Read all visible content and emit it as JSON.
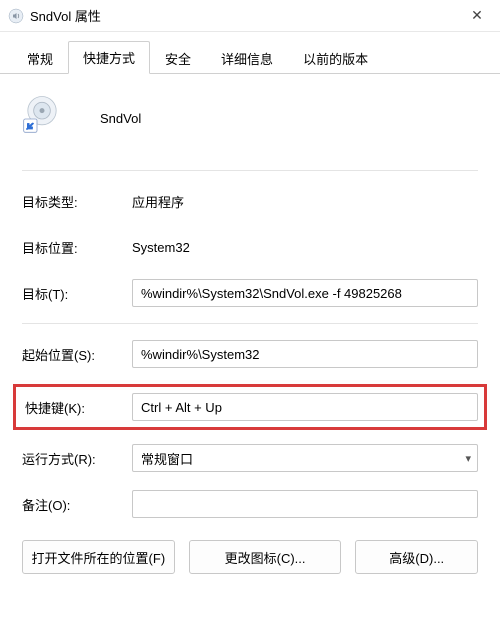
{
  "titlebar": {
    "title": "SndVol 属性",
    "close_glyph": "✕"
  },
  "tabs": [
    {
      "label": "常规",
      "active": false
    },
    {
      "label": "快捷方式",
      "active": true
    },
    {
      "label": "安全",
      "active": false
    },
    {
      "label": "详细信息",
      "active": false
    },
    {
      "label": "以前的版本",
      "active": false
    }
  ],
  "header": {
    "app_name": "SndVol"
  },
  "fields": {
    "target_type_label": "目标类型:",
    "target_type_value": "应用程序",
    "target_location_label": "目标位置:",
    "target_location_value": "System32",
    "target_label": "目标(T):",
    "target_value": "%windir%\\System32\\SndVol.exe -f 49825268",
    "start_in_label": "起始位置(S):",
    "start_in_value": "%windir%\\System32",
    "shortcut_key_label": "快捷键(K):",
    "shortcut_key_value": "Ctrl + Alt + Up",
    "run_label": "运行方式(R):",
    "run_value": "常规窗口",
    "comment_label": "备注(O):",
    "comment_value": ""
  },
  "buttons": {
    "open_location": "打开文件所在的位置(F)",
    "change_icon": "更改图标(C)...",
    "advanced": "高级(D)..."
  },
  "highlight_color": "#d83a3a"
}
